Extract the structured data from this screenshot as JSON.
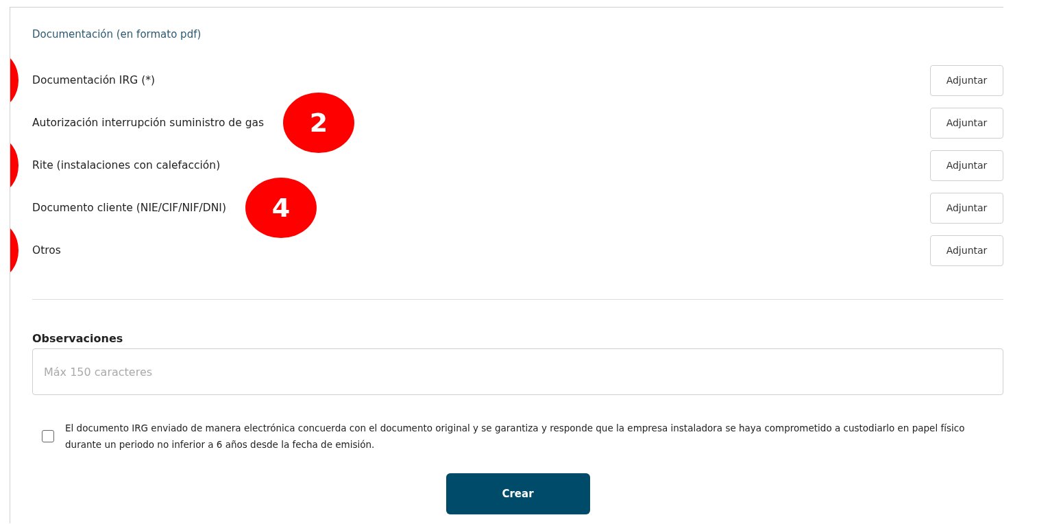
{
  "documentation": {
    "title": "Documentación (en formato pdf)",
    "rows": [
      {
        "label": "Documentación IRG (*)",
        "button": "Adjuntar",
        "marker": {
          "kind": "edge"
        }
      },
      {
        "label": "Autorización interrupción suministro de gas",
        "button": "Adjuntar",
        "marker": {
          "kind": "inline",
          "label": "2"
        }
      },
      {
        "label": "Rite (instalaciones con calefacción)",
        "button": "Adjuntar",
        "marker": {
          "kind": "edge"
        }
      },
      {
        "label": "Documento cliente (NIE/CIF/NIF/DNI)",
        "button": "Adjuntar",
        "marker": {
          "kind": "inline",
          "label": "4"
        }
      },
      {
        "label": "Otros",
        "button": "Adjuntar",
        "marker": {
          "kind": "edge"
        }
      }
    ]
  },
  "observations": {
    "label": "Observaciones",
    "placeholder": "Máx 150 caracteres"
  },
  "consent": {
    "checked": false,
    "text": "El documento IRG enviado de manera electrónica concuerda con el documento original y se garantiza y responde que la empresa instaladora se haya comprometido a custodiarlo en papel físico durante un periodo no inferior a 6 años desde la fecha de emisión."
  },
  "submit_button": "Crear"
}
